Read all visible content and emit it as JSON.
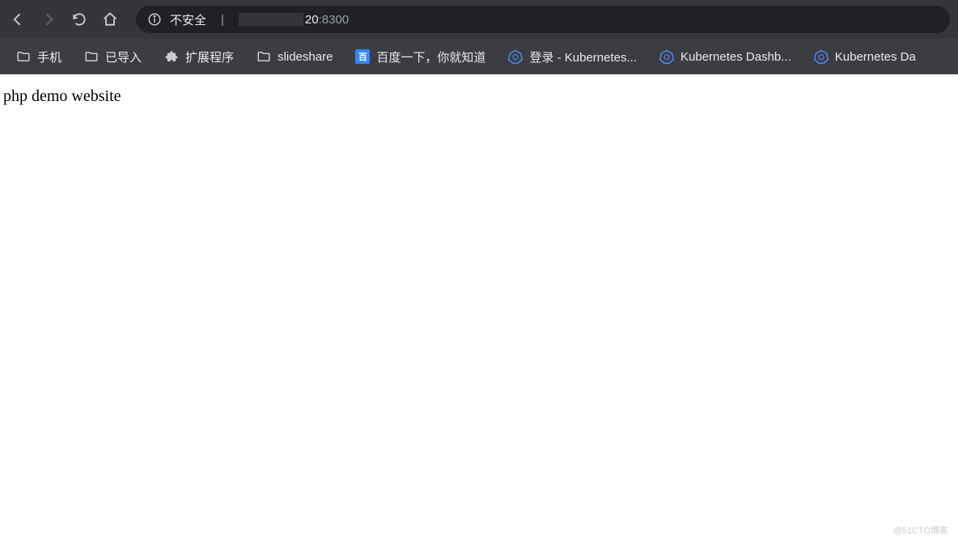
{
  "toolbar": {
    "insecure_label": "不安全",
    "url_visible": "20",
    "url_port": ":8300"
  },
  "bookmarks": {
    "items": [
      {
        "label": "手机",
        "icon": "folder"
      },
      {
        "label": "已导入",
        "icon": "folder"
      },
      {
        "label": "扩展程序",
        "icon": "puzzle"
      },
      {
        "label": "slideshare",
        "icon": "folder"
      },
      {
        "label": "百度一下，你就知道",
        "icon": "baidu"
      },
      {
        "label": "登录 - Kubernetes...",
        "icon": "k8s"
      },
      {
        "label": "Kubernetes Dashb...",
        "icon": "k8s"
      },
      {
        "label": "Kubernetes Da",
        "icon": "k8s"
      }
    ]
  },
  "page": {
    "content": "php demo website"
  },
  "watermark": "@51CTO博客"
}
